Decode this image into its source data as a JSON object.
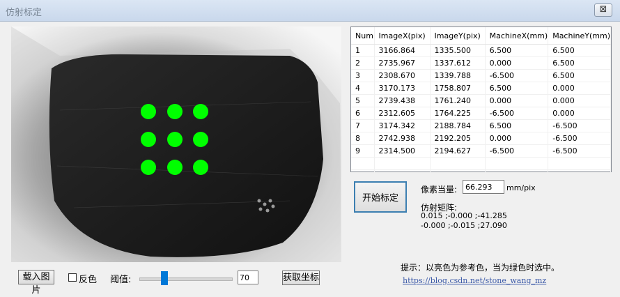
{
  "window": {
    "title": "仿射标定",
    "close_glyph": "⊠"
  },
  "table": {
    "headers": [
      "Num",
      "ImageX(pix)",
      "ImageY(pix)",
      "MachineX(mm)",
      "MachineY(mm)"
    ],
    "rows": [
      [
        "1",
        "3166.864",
        "1335.500",
        "6.500",
        "6.500"
      ],
      [
        "2",
        "2735.967",
        "1337.612",
        "0.000",
        "6.500"
      ],
      [
        "3",
        "2308.670",
        "1339.788",
        "-6.500",
        "6.500"
      ],
      [
        "4",
        "3170.173",
        "1758.807",
        "6.500",
        "0.000"
      ],
      [
        "5",
        "2739.438",
        "1761.240",
        "0.000",
        "0.000"
      ],
      [
        "6",
        "2312.605",
        "1764.225",
        "-6.500",
        "0.000"
      ],
      [
        "7",
        "3174.342",
        "2188.784",
        "6.500",
        "-6.500"
      ],
      [
        "8",
        "2742.938",
        "2192.205",
        "0.000",
        "-6.500"
      ],
      [
        "9",
        "2314.500",
        "2194.627",
        "-6.500",
        "-6.500"
      ]
    ]
  },
  "calib": {
    "start_label": "开始标定",
    "pixel_equiv_label": "像素当量:",
    "pixel_equiv_value": "66.293",
    "pixel_unit": "mm/pix",
    "affine_label": "仿射矩阵:",
    "affine_row1": "0.015 ;-0.000 ;-41.285",
    "affine_row2": "-0.000 ;-0.015 ;27.090"
  },
  "controls": {
    "load_image": "载入图片",
    "invert_label": "反色",
    "threshold_label": "阈值:",
    "threshold_value": "70",
    "threshold_fraction": 0.27,
    "get_coords": "获取坐标"
  },
  "hint": {
    "text": "提示：以亮色为参考色，当为绿色时选中。",
    "link": "https://blog.csdn.net/stone_wang_mz"
  },
  "colors": {
    "dot": "#00ff00",
    "accent": "#0078d7"
  }
}
